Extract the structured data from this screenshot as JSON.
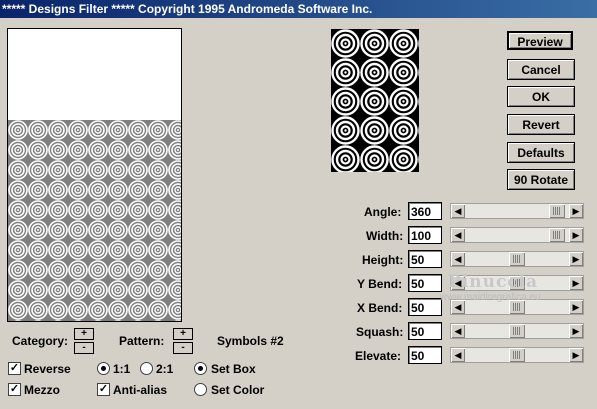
{
  "window": {
    "title": "***** Designs Filter *****  Copyright 1995 Andromeda Software Inc."
  },
  "buttons": {
    "preview": "Preview",
    "cancel": "Cancel",
    "ok": "OK",
    "revert": "Revert",
    "defaults": "Defaults",
    "rotate": "90 Rotate"
  },
  "params": [
    {
      "label": "Angle:",
      "value": "360",
      "level": 0.96
    },
    {
      "label": "Width:",
      "value": "100",
      "level": 0.96
    },
    {
      "label": "Height:",
      "value": "50",
      "level": 0.5
    },
    {
      "label": "Y Bend:",
      "value": "50",
      "level": 0.5
    },
    {
      "label": "X Bend:",
      "value": "50",
      "level": 0.5
    },
    {
      "label": "Squash:",
      "value": "50",
      "level": 0.5
    },
    {
      "label": "Elevate:",
      "value": "50",
      "level": 0.5
    }
  ],
  "controls": {
    "category_label": "Category:",
    "pattern_label": "Pattern:",
    "pattern_name": "Symbols #2",
    "spin_plus": "+",
    "spin_minus": "-"
  },
  "options": {
    "reverse": {
      "label": "Reverse",
      "checked": true
    },
    "mezzo": {
      "label": "Mezzo",
      "checked": true
    },
    "ratio_1_1": {
      "label": "1:1",
      "selected": true
    },
    "ratio_2_1": {
      "label": "2:1",
      "selected": false
    },
    "antialias": {
      "label": "Anti-alias",
      "checked": true
    },
    "set_box": {
      "label": "Set Box",
      "selected": true
    },
    "set_color": {
      "label": "Set Color",
      "selected": false
    }
  },
  "watermark": {
    "name": "Pinuccia",
    "site": "www.maidiregrafica.eu"
  },
  "colors": {
    "dialog": "#d4d0c8",
    "titlebar": "#0a246a"
  }
}
